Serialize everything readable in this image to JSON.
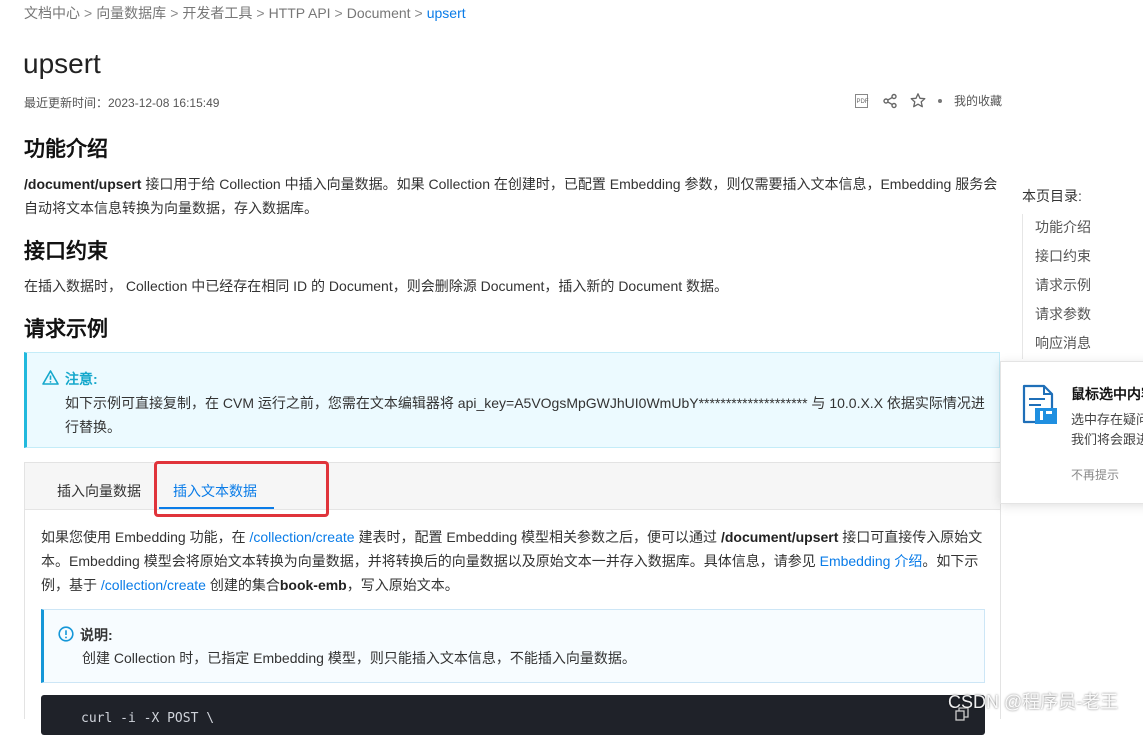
{
  "breadcrumb": {
    "items": [
      "文档中心",
      "向量数据库",
      "开发者工具",
      "HTTP API",
      "Document",
      "upsert"
    ],
    "separator": ">"
  },
  "page": {
    "title": "upsert",
    "updated": "最近更新时间：2023-12-08 16:15:49"
  },
  "tools": {
    "pdf_text": "PDF",
    "favorites_label": "我的收藏"
  },
  "sections": {
    "intro_heading": "功能介绍",
    "intro_bold": "/document/upsert",
    "intro_text": " 接口用于给 Collection 中插入向量数据。如果 Collection 在创建时，已配置 Embedding 参数，则仅需要插入文本信息，Embedding 服务会自动将文本信息转换为向量数据，存入数据库。",
    "constraint_heading": "接口约束",
    "constraint_text": "在插入数据时， Collection 中已经存在相同 ID 的 Document，则会删除源 Document，插入新的 Document 数据。",
    "example_heading": "请求示例"
  },
  "notice": {
    "title": "注意:",
    "text": "如下示例可直接复制，在 CVM 运行之前，您需在文本编辑器将 api_key=A5VOgsMpGWJhUI0WmUbY******************** 与 10.0.X.X 依据实际情况进行替换。"
  },
  "tabs": {
    "tab1": "插入向量数据",
    "tab2": "插入文本数据"
  },
  "tab_content": {
    "p1": "如果您使用 Embedding 功能，在 ",
    "link1": "/collection/create",
    "p2": " 建表时，配置 Embedding 模型相关参数之后，便可以通过 ",
    "bold1": "/document/upsert",
    "p3": " 接口可直接传入原始文本。Embedding 模型会将原始文本转换为向量数据，并将转换后的向量数据以及原始文本一并存入数据库。具体信息，请参见 ",
    "link2": "Embedding 介绍",
    "p4": "。如下示例，基于 ",
    "link3": "/collection/create",
    "p5": " 创建的集合",
    "bold2": "book-emb",
    "p6": "，写入原始文本。"
  },
  "info": {
    "title": "说明:",
    "text": "创建 Collection 时，已指定 Embedding 模型，则只能插入文本信息，不能插入向量数据。"
  },
  "code": {
    "line1": "curl -i -X POST \\"
  },
  "toc": {
    "title": "本页目录:",
    "items": [
      "功能介绍",
      "接口约束",
      "请求示例",
      "请求参数",
      "响应消息"
    ]
  },
  "popup": {
    "title": "鼠标选中内容",
    "line1": "选中存在疑问",
    "line2": "我们将会跟进",
    "dismiss": "不再提示"
  },
  "watermark": "CSDN @程序员-老王",
  "colors": {
    "link": "#0a7ce8",
    "notice_accent": "#21b9dd",
    "highlight": "#e0343b"
  }
}
